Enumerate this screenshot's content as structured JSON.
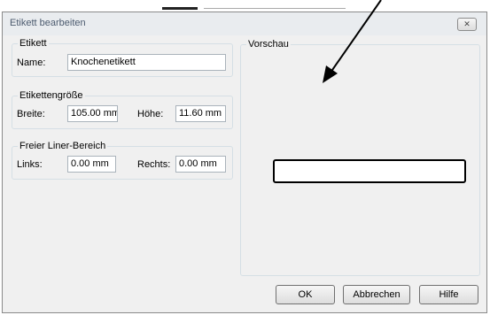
{
  "dialog": {
    "title": "Etikett bearbeiten",
    "close_icon": "close-icon"
  },
  "etikett": {
    "group_label": "Etikett",
    "name_label": "Name:",
    "name_value": "Knochenetikett"
  },
  "size": {
    "group_label": "Etikettengröße",
    "width_label": "Breite:",
    "width_value": "105.00 mm",
    "height_label": "Höhe:",
    "height_value": "11.60 mm"
  },
  "liner": {
    "group_label": "Freier Liner-Bereich",
    "left_label": "Links:",
    "left_value": "0.00 mm",
    "right_label": "Rechts:",
    "right_value": "0.00 mm"
  },
  "preview": {
    "group_label": "Vorschau"
  },
  "buttons": {
    "ok": "OK",
    "cancel": "Abbrechen",
    "help": "Hilfe"
  }
}
